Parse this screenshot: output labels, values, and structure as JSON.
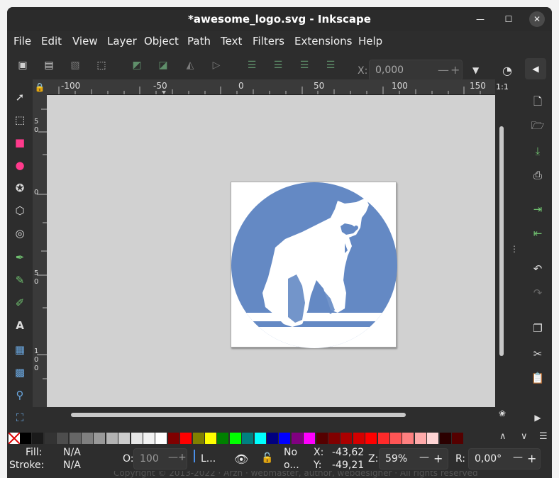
{
  "window": {
    "title": "*awesome_logo.svg - Inkscape"
  },
  "menubar": [
    "File",
    "Edit",
    "View",
    "Layer",
    "Object",
    "Path",
    "Text",
    "Filters",
    "Extensions",
    "Help"
  ],
  "toolbar": {
    "x_label": "X:",
    "x_value": "0,000"
  },
  "ruler_top": [
    "-100",
    "-50",
    "0",
    "50",
    "100",
    "150"
  ],
  "ruler_left": [
    "5",
    "0",
    "0",
    "5",
    "0",
    "1",
    "0",
    "0"
  ],
  "zoom_fit_label": "1:1",
  "palette": {
    "colors": [
      "#000000",
      "#1a1a1a",
      "#333333",
      "#4d4d4d",
      "#666666",
      "#808080",
      "#999999",
      "#b3b3b3",
      "#cccccc",
      "#e6e6e6",
      "#f2f2f2",
      "#ffffff",
      "#800000",
      "#ff0000",
      "#808000",
      "#ffff00",
      "#008000",
      "#00ff00",
      "#008080",
      "#00ffff",
      "#000080",
      "#0000ff",
      "#800080",
      "#ff00ff",
      "#550000",
      "#800000",
      "#aa0000",
      "#d40000",
      "#ff0000",
      "#ff2a2a",
      "#ff5555",
      "#ff8080",
      "#ffaaaa",
      "#ffd5d5",
      "#2b0000",
      "#550000"
    ]
  },
  "status": {
    "fill_label": "Fill:",
    "fill_value": "N/A",
    "stroke_label": "Stroke:",
    "stroke_value": "N/A",
    "opacity_label": "O:",
    "opacity_value": "100",
    "layer_label": "L...",
    "no_label": "No",
    "o_label": "o...",
    "x_label": "X:",
    "x_value": "-43,62",
    "y_label": "Y:",
    "y_value": "-49,21",
    "zoom_label": "Z:",
    "zoom_value": "59%",
    "rotation_label": "R:",
    "rotation_value": "0,00°"
  },
  "footer": "Copyright © 2013-2022 · Arzh · webmaster, author, webdesigner · All rights reserved",
  "colors": {
    "logo_blue": "#6489c4",
    "canvas": "#d1d1d1",
    "chrome": "#2d2d2d"
  }
}
